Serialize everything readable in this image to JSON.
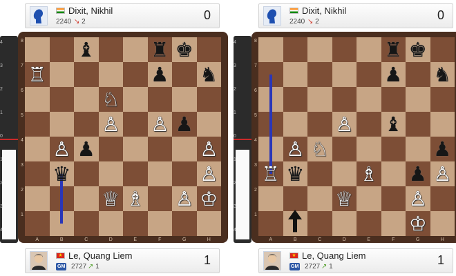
{
  "panels": [
    {
      "top_player": {
        "name": "Dixit, Nikhil",
        "rating": "2240",
        "delta": "2",
        "score": "0",
        "flag": "India"
      },
      "bottom_player": {
        "name": "Le, Quang Liem",
        "title": "GM",
        "rating": "2727",
        "delta": "1",
        "score": "1",
        "flag": "Vietnam"
      },
      "pieces": [
        {
          "sq": "c8",
          "color": "black",
          "glyph": "♝"
        },
        {
          "sq": "f8",
          "color": "black",
          "glyph": "♜"
        },
        {
          "sq": "g8",
          "color": "black",
          "glyph": "♚"
        },
        {
          "sq": "a7",
          "color": "white",
          "glyph": "♖"
        },
        {
          "sq": "f7",
          "color": "black",
          "glyph": "♟"
        },
        {
          "sq": "h7",
          "color": "black",
          "glyph": "♞"
        },
        {
          "sq": "d6",
          "color": "white",
          "glyph": "♘"
        },
        {
          "sq": "d5",
          "color": "white",
          "glyph": "♙"
        },
        {
          "sq": "f5",
          "color": "white",
          "glyph": "♙"
        },
        {
          "sq": "g5",
          "color": "black",
          "glyph": "♟"
        },
        {
          "sq": "b4",
          "color": "white",
          "glyph": "♙"
        },
        {
          "sq": "c4",
          "color": "black",
          "glyph": "♟"
        },
        {
          "sq": "h4",
          "color": "white",
          "glyph": "♙"
        },
        {
          "sq": "b3",
          "color": "black",
          "glyph": "♛"
        },
        {
          "sq": "h3",
          "color": "white",
          "glyph": "♙"
        },
        {
          "sq": "d2",
          "color": "white",
          "glyph": "♕"
        },
        {
          "sq": "e2",
          "color": "white",
          "glyph": "♗"
        },
        {
          "sq": "g2",
          "color": "white",
          "glyph": "♙"
        },
        {
          "sq": "h2",
          "color": "white",
          "glyph": "♔"
        }
      ],
      "highlight_line": {
        "file": "b",
        "from_rank": 3,
        "to_rank": 1
      },
      "eval_white_fraction": 0.45
    },
    {
      "top_player": {
        "name": "Dixit, Nikhil",
        "rating": "2240",
        "delta": "2",
        "score": "0",
        "flag": "India"
      },
      "bottom_player": {
        "name": "Le, Quang Liem",
        "title": "GM",
        "rating": "2727",
        "delta": "1",
        "score": "1",
        "flag": "Vietnam"
      },
      "pieces": [
        {
          "sq": "f8",
          "color": "black",
          "glyph": "♜"
        },
        {
          "sq": "g8",
          "color": "black",
          "glyph": "♚"
        },
        {
          "sq": "f7",
          "color": "black",
          "glyph": "♟"
        },
        {
          "sq": "h7",
          "color": "black",
          "glyph": "♞"
        },
        {
          "sq": "d5",
          "color": "white",
          "glyph": "♙"
        },
        {
          "sq": "f5",
          "color": "black",
          "glyph": "♝"
        },
        {
          "sq": "b4",
          "color": "white",
          "glyph": "♙"
        },
        {
          "sq": "c4",
          "color": "white",
          "glyph": "♘"
        },
        {
          "sq": "h4",
          "color": "black",
          "glyph": "♟"
        },
        {
          "sq": "a3",
          "color": "white",
          "glyph": "♖"
        },
        {
          "sq": "b3",
          "color": "black",
          "glyph": "♛"
        },
        {
          "sq": "e3",
          "color": "white",
          "glyph": "♗"
        },
        {
          "sq": "g3",
          "color": "black",
          "glyph": "♟"
        },
        {
          "sq": "h3",
          "color": "white",
          "glyph": "♙"
        },
        {
          "sq": "d2",
          "color": "white",
          "glyph": "♕"
        },
        {
          "sq": "g2",
          "color": "white",
          "glyph": "♙"
        },
        {
          "sq": "g1",
          "color": "white",
          "glyph": "♔"
        }
      ],
      "highlight_line": {
        "file": "a",
        "from_rank": 7,
        "to_rank": 3
      },
      "black_arrow": {
        "file": "b",
        "from_rank": 1,
        "to_rank": 2
      },
      "eval_white_fraction": 0.45
    }
  ],
  "files": [
    "A",
    "B",
    "C",
    "D",
    "E",
    "F",
    "G",
    "H"
  ],
  "ranks": [
    "8",
    "7",
    "6",
    "5",
    "4",
    "3",
    "2",
    "1"
  ],
  "eval_labels": [
    "4",
    "3",
    "2",
    "1",
    "0",
    "1",
    "2",
    "3",
    "4"
  ],
  "colors": {
    "highlight": "#2a36b8",
    "arrow": "#111111",
    "light_square": "#c7a585",
    "dark_square": "#7d4e36"
  }
}
